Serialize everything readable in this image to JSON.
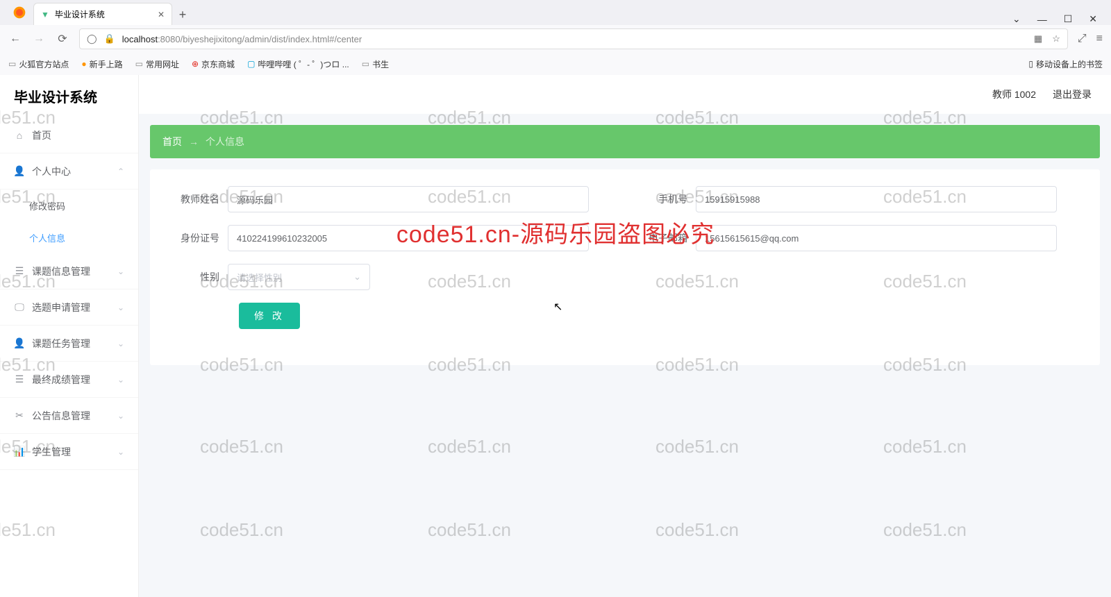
{
  "browser": {
    "tab_title": "毕业设计系统",
    "url_host": "localhost",
    "url_port": ":8080",
    "url_path": "/biyeshejixitong/admin/dist/index.html#/center",
    "bookmarks": [
      "火狐官方站点",
      "新手上路",
      "常用网址",
      "京东商城",
      "哔哩哔哩 ( ゜- ゜)つロ ...",
      "书生"
    ],
    "mobile_bookmarks": "移动设备上的书签"
  },
  "app": {
    "title": "毕业设计系统",
    "user": "教师 1002",
    "logout": "退出登录",
    "menu": {
      "home": "首页",
      "personal": "个人中心",
      "change_pwd": "修改密码",
      "profile": "个人信息",
      "topic_info": "课题信息管理",
      "topic_apply": "选题申请管理",
      "topic_task": "课题任务管理",
      "final_score": "最终成绩管理",
      "notice": "公告信息管理",
      "student": "学生管理"
    }
  },
  "breadcrumb": {
    "home": "首页",
    "arrow": "→",
    "current": "个人信息"
  },
  "form": {
    "labels": {
      "name": "教师姓名",
      "idcard": "身份证号",
      "gender": "性别",
      "phone": "手机号",
      "email": "电子邮箱"
    },
    "values": {
      "name": "源码乐园",
      "idcard": "410224199610232005",
      "phone": "15915915988",
      "email": "15615615615@qq.com"
    },
    "gender_placeholder": "请选择性别",
    "submit": "修 改"
  },
  "watermark": {
    "text": "code51.cn",
    "center": "code51.cn-源码乐园盗图必究"
  }
}
